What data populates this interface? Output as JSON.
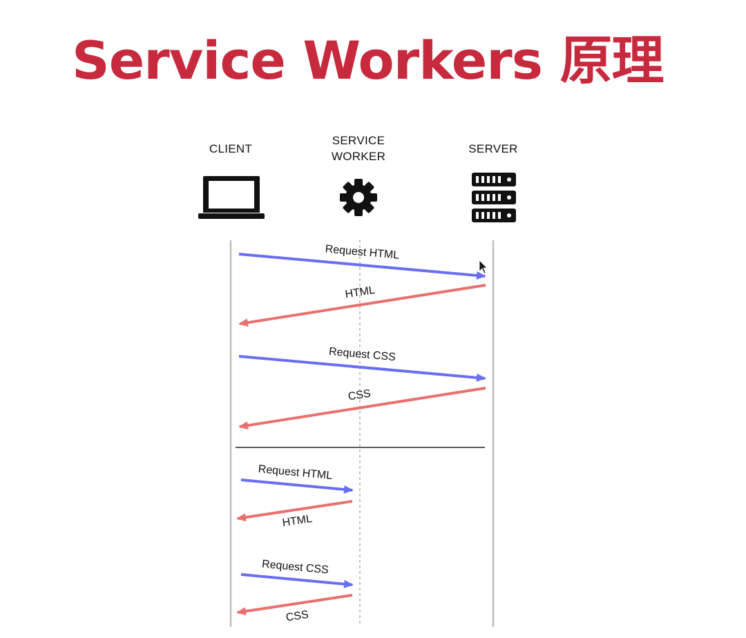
{
  "title": "Service Workers 原理",
  "colors": {
    "title": "#c7293d",
    "request": "#6a6ef0",
    "response": "#e8716f",
    "lifeline": "#bdbdbd",
    "divider": "#222222",
    "icon": "#111111"
  },
  "actors": {
    "client": {
      "label": "CLIENT",
      "icon": "laptop-icon"
    },
    "worker": {
      "line1": "SERVICE",
      "line2": "WORKER",
      "icon": "gear-icon"
    },
    "server": {
      "label": "SERVER",
      "icon": "server-rack-icon"
    }
  },
  "messages": {
    "online_request_html": "Request HTML",
    "online_html": "HTML",
    "online_request_css": "Request CSS",
    "online_css": "CSS",
    "cached_request_html": "Request HTML",
    "cached_html": "HTML",
    "cached_request_css": "Request CSS",
    "cached_css": "CSS"
  }
}
